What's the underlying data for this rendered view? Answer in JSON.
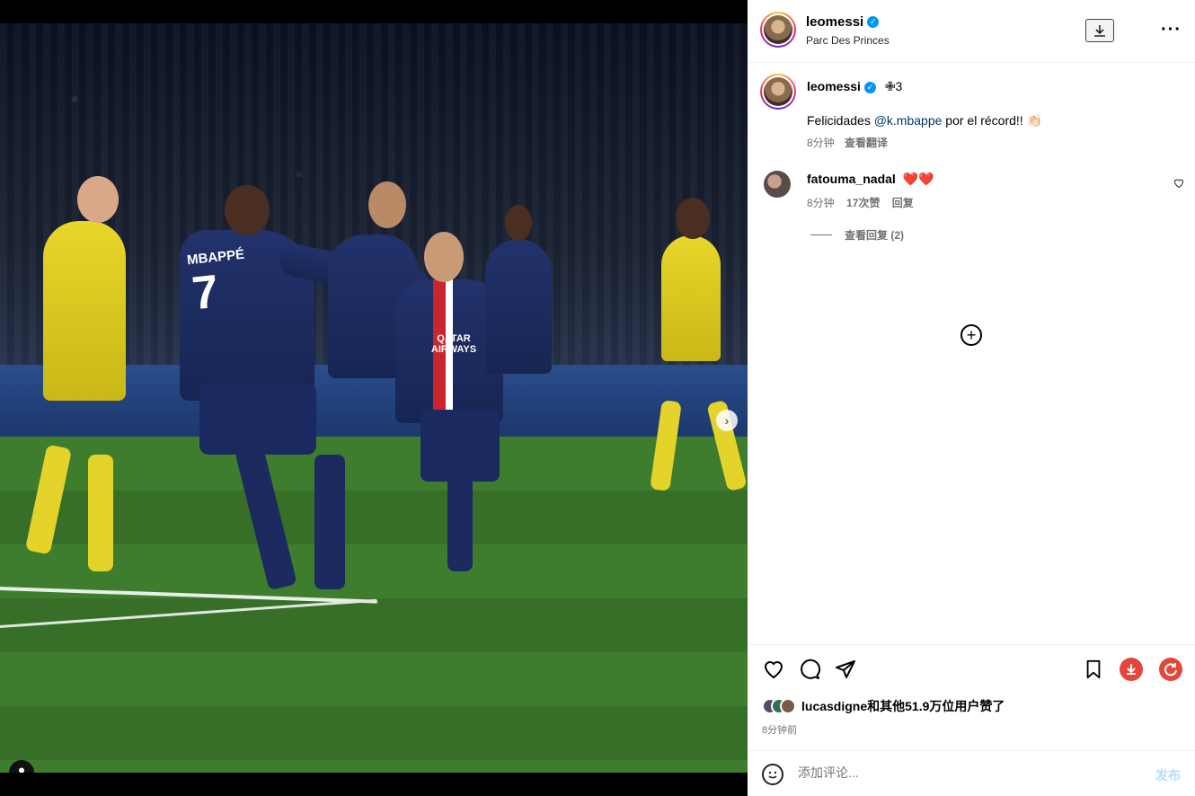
{
  "post": {
    "username": "leomessi",
    "location": "Parc Des Princes",
    "caption_username": "leomessi",
    "caption_badges": "✙3",
    "caption_text_prefix": "Felicidades ",
    "caption_mention": "@k.mbappe",
    "caption_text_suffix": " por el récord!! 👏🏻",
    "caption_time": "8分钟",
    "caption_translate": "查看翻译"
  },
  "comments": [
    {
      "username": "fatouma_nadal",
      "text": "❤️❤️",
      "time": "8分钟",
      "likes": "17次赞",
      "reply": "回复",
      "view_replies": "查看回复 (2)"
    }
  ],
  "actions": {
    "liked_by_user": "lucasdigne",
    "liked_by_suffix": "和其他51.9万位用户赞了",
    "time_ago": "8分钟前"
  },
  "comment_bar": {
    "placeholder": "添加评论...",
    "post_label": "发布"
  },
  "media": {
    "jersey_name": "MBAPPÉ",
    "jersey_number": "7",
    "sponsor": "QATAR AIRWAYS",
    "carousel_count": 4,
    "carousel_active": 1
  },
  "colors": {
    "verified": "#0095f6",
    "mention": "#00376b",
    "muted": "#737373",
    "post_button": "#b2dffc",
    "accent_red": "#e4473a"
  }
}
